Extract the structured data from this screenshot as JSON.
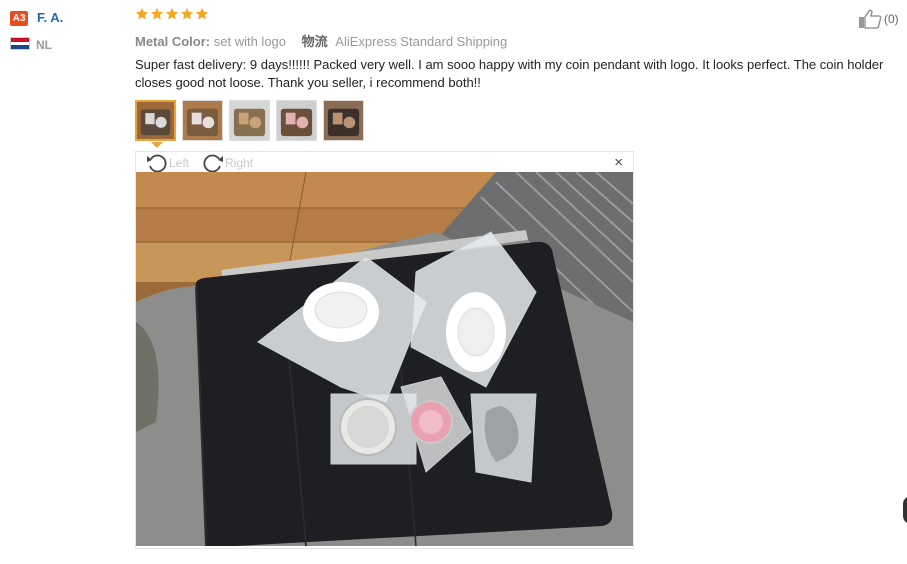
{
  "user": {
    "badge": "A3",
    "name": "F. A.",
    "country": "NL",
    "flag_icon": "netherlands-flag-icon"
  },
  "review": {
    "rating": 5,
    "star_color": "#f5a623",
    "meta_key": "Metal Color:",
    "meta_value": "set with logo",
    "shipping_icon": "物流",
    "shipping_text": "AliExpress Standard Shipping",
    "text": "Super fast delivery: 9 days!!!!!! Packed very well. I am sooo happy with my coin pendant with logo. It looks perfect. The coin holder closes good not loose. Thank you seller, i recommend both!!",
    "helpful_count": "(0)"
  },
  "thumbnails": [
    {
      "name": "photo-1",
      "active": true
    },
    {
      "name": "photo-2",
      "active": false
    },
    {
      "name": "photo-3",
      "active": false
    },
    {
      "name": "photo-4",
      "active": false
    },
    {
      "name": "photo-5",
      "active": false
    }
  ],
  "viewer": {
    "rotate_left": "Left",
    "rotate_right": "Right",
    "close": "×"
  },
  "colors": {
    "link": "#1f6bb7",
    "badge": "#e94d1f",
    "active_border": "#e8a33d"
  }
}
